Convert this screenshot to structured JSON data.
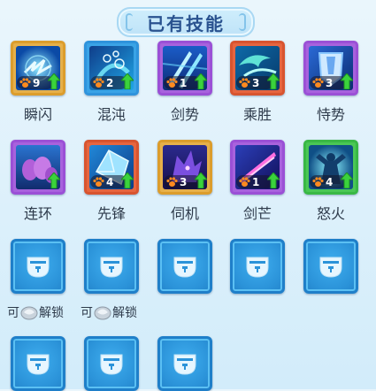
{
  "title": "已有技能",
  "skills": [
    {
      "name": "瞬闪",
      "level": "9",
      "frame": "orange",
      "art": "lightning"
    },
    {
      "name": "混沌",
      "level": "2",
      "frame": "blue",
      "art": "bubbles"
    },
    {
      "name": "剑势",
      "level": "1",
      "frame": "purple",
      "art": "swords"
    },
    {
      "name": "乘胜",
      "level": "3",
      "frame": "red",
      "art": "wave"
    },
    {
      "name": "恃势",
      "level": "3",
      "frame": "purple",
      "art": "shield"
    },
    {
      "name": "连环",
      "level": "",
      "frame": "purple",
      "art": "claws"
    },
    {
      "name": "先锋",
      "level": "4",
      "frame": "red",
      "art": "crystal"
    },
    {
      "name": "伺机",
      "level": "3",
      "frame": "orange",
      "art": "wolf"
    },
    {
      "name": "剑芒",
      "level": "1",
      "frame": "purple",
      "art": "beam"
    },
    {
      "name": "怒火",
      "level": "4",
      "frame": "green",
      "art": "fury"
    }
  ],
  "locked_hint": [
    "可",
    "解锁"
  ],
  "colors": {
    "upgrade_arrow": "#3bd23c",
    "lock_slot": "#2b93d9",
    "title_text": "#29528f"
  },
  "icons": {
    "level_icon": "paw-icon",
    "upgrade": "arrow-up-icon",
    "lock": "lock-icon",
    "unlock_currency": "gem-icon"
  }
}
